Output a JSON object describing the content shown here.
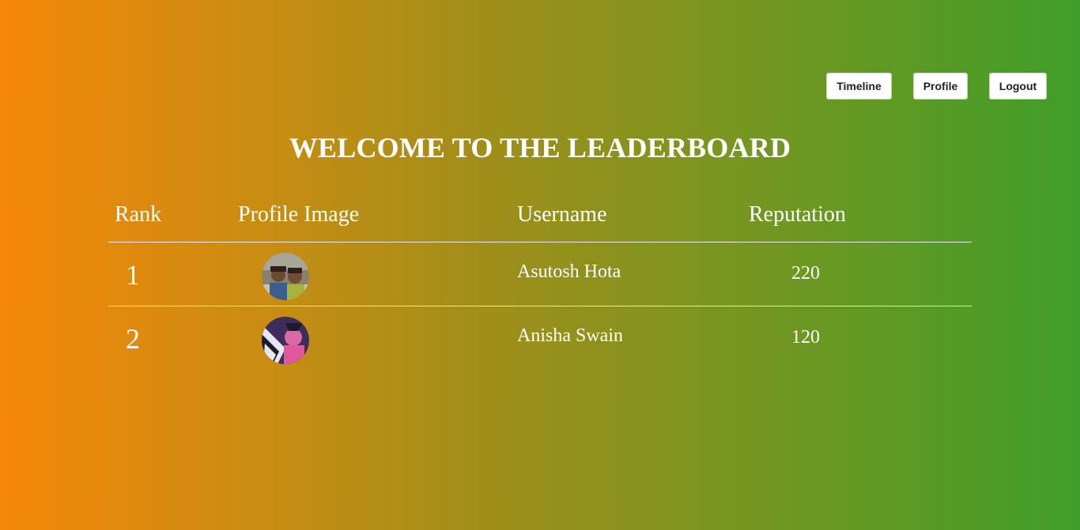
{
  "nav": {
    "timeline_label": "Timeline",
    "profile_label": "Profile",
    "logout_label": "Logout"
  },
  "title": "WELCOME TO THE LEADERBOARD",
  "leaderboard": {
    "columns": [
      "Rank",
      "Profile Image",
      "Username",
      "Reputation"
    ],
    "rows": [
      {
        "rank": "1",
        "username": "Asutosh Hota",
        "reputation": "220"
      },
      {
        "rank": "2",
        "username": "Anisha Swain",
        "reputation": "120"
      }
    ]
  },
  "colors": {
    "gradient_start": "#f5870a",
    "gradient_end": "#3f9e29",
    "text": "#ffffff"
  }
}
